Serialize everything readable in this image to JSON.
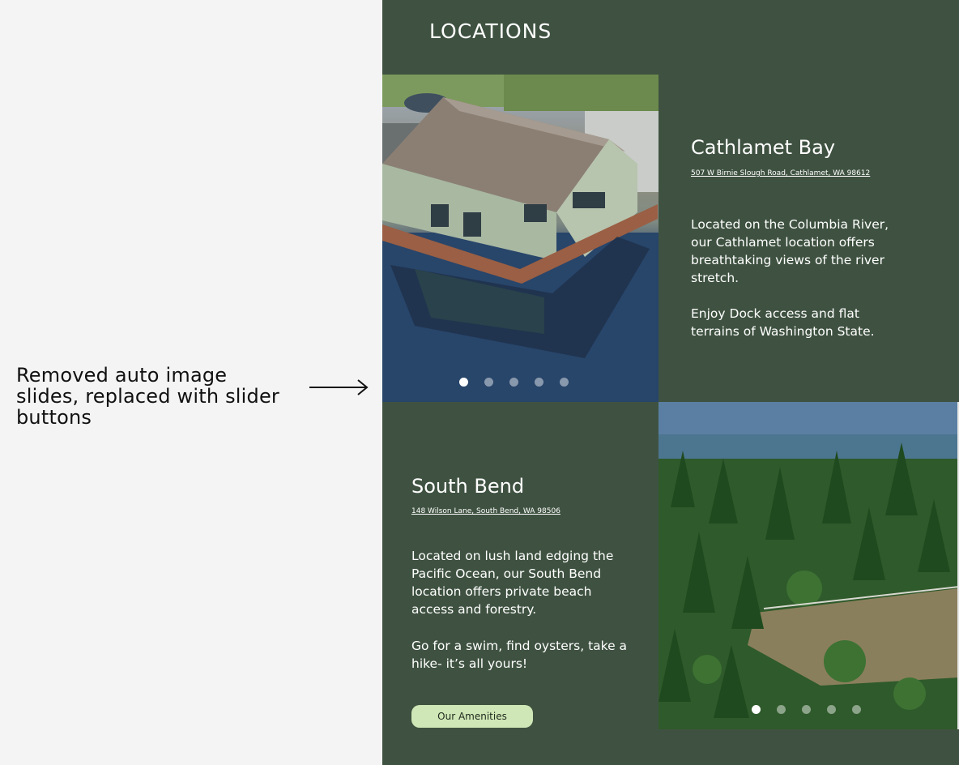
{
  "annotation": {
    "note": "Removed auto image slides, replaced with slider buttons"
  },
  "section": {
    "title": "LOCATIONS"
  },
  "locations": [
    {
      "name": "Cathlamet Bay",
      "address": "507 W Birnie Slough Road, Cathlamet, WA 98612",
      "description": "Located on the Columbia River, our Cathlamet location offers breathtaking views of the river stretch.",
      "description_2": "Enjoy Dock access and flat terrains of Washington State.",
      "slider": {
        "count": 5,
        "active_index": 0
      }
    },
    {
      "name": "South Bend",
      "address": "148 Wilson Lane, South Bend, WA 98506",
      "description": "Located on lush land edging the Pacific Ocean, our South Bend location offers private beach access and forestry.",
      "description_2": "Go for a swim, find oysters, take a hike- it’s all yours!",
      "slider": {
        "count": 5,
        "active_index": 0
      }
    }
  ],
  "cta": {
    "label": "Our Amenities"
  },
  "colors": {
    "panel_bg": "#3f5241",
    "button_bg": "#cfe6b6",
    "page_bg": "#f4f4f4"
  }
}
